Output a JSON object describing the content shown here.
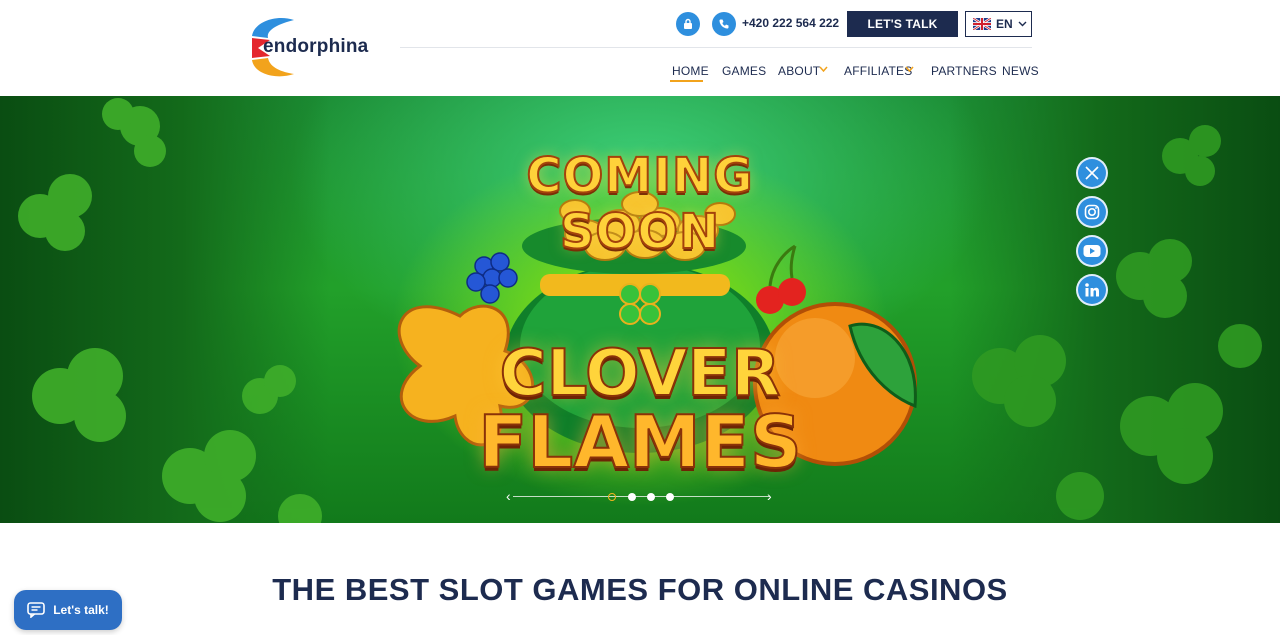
{
  "brand": {
    "name": "endorphina",
    "colors": {
      "navy": "#1d2b4f",
      "blue": "#2e8fde",
      "accent": "#f2a31c"
    }
  },
  "header": {
    "phone": "+420 222 564 222",
    "cta_label": "LET'S TALK",
    "language": "EN",
    "icons": {
      "lock": "lock-icon",
      "phone": "phone-icon",
      "flag": "uk-flag-icon"
    }
  },
  "nav": {
    "items": [
      {
        "label": "HOME",
        "active": true,
        "dropdown": false
      },
      {
        "label": "GAMES",
        "active": false,
        "dropdown": false
      },
      {
        "label": "ABOUT",
        "active": false,
        "dropdown": true
      },
      {
        "label": "AFFILIATES",
        "active": false,
        "dropdown": true
      },
      {
        "label": "PARTNERS",
        "active": false,
        "dropdown": false
      },
      {
        "label": "NEWS",
        "active": false,
        "dropdown": false
      }
    ]
  },
  "hero": {
    "banner_top": "COMING SOON",
    "game_title_line1": "CLOVER",
    "game_title_line2": "FLAMES",
    "slides_count": 4,
    "active_slide": 1
  },
  "social": [
    "x-icon",
    "instagram-icon",
    "youtube-icon",
    "linkedin-icon"
  ],
  "main": {
    "heading": "THE BEST SLOT GAMES FOR ONLINE CASINOS"
  },
  "chat": {
    "label": "Let's talk!",
    "icon": "chat-icon"
  }
}
